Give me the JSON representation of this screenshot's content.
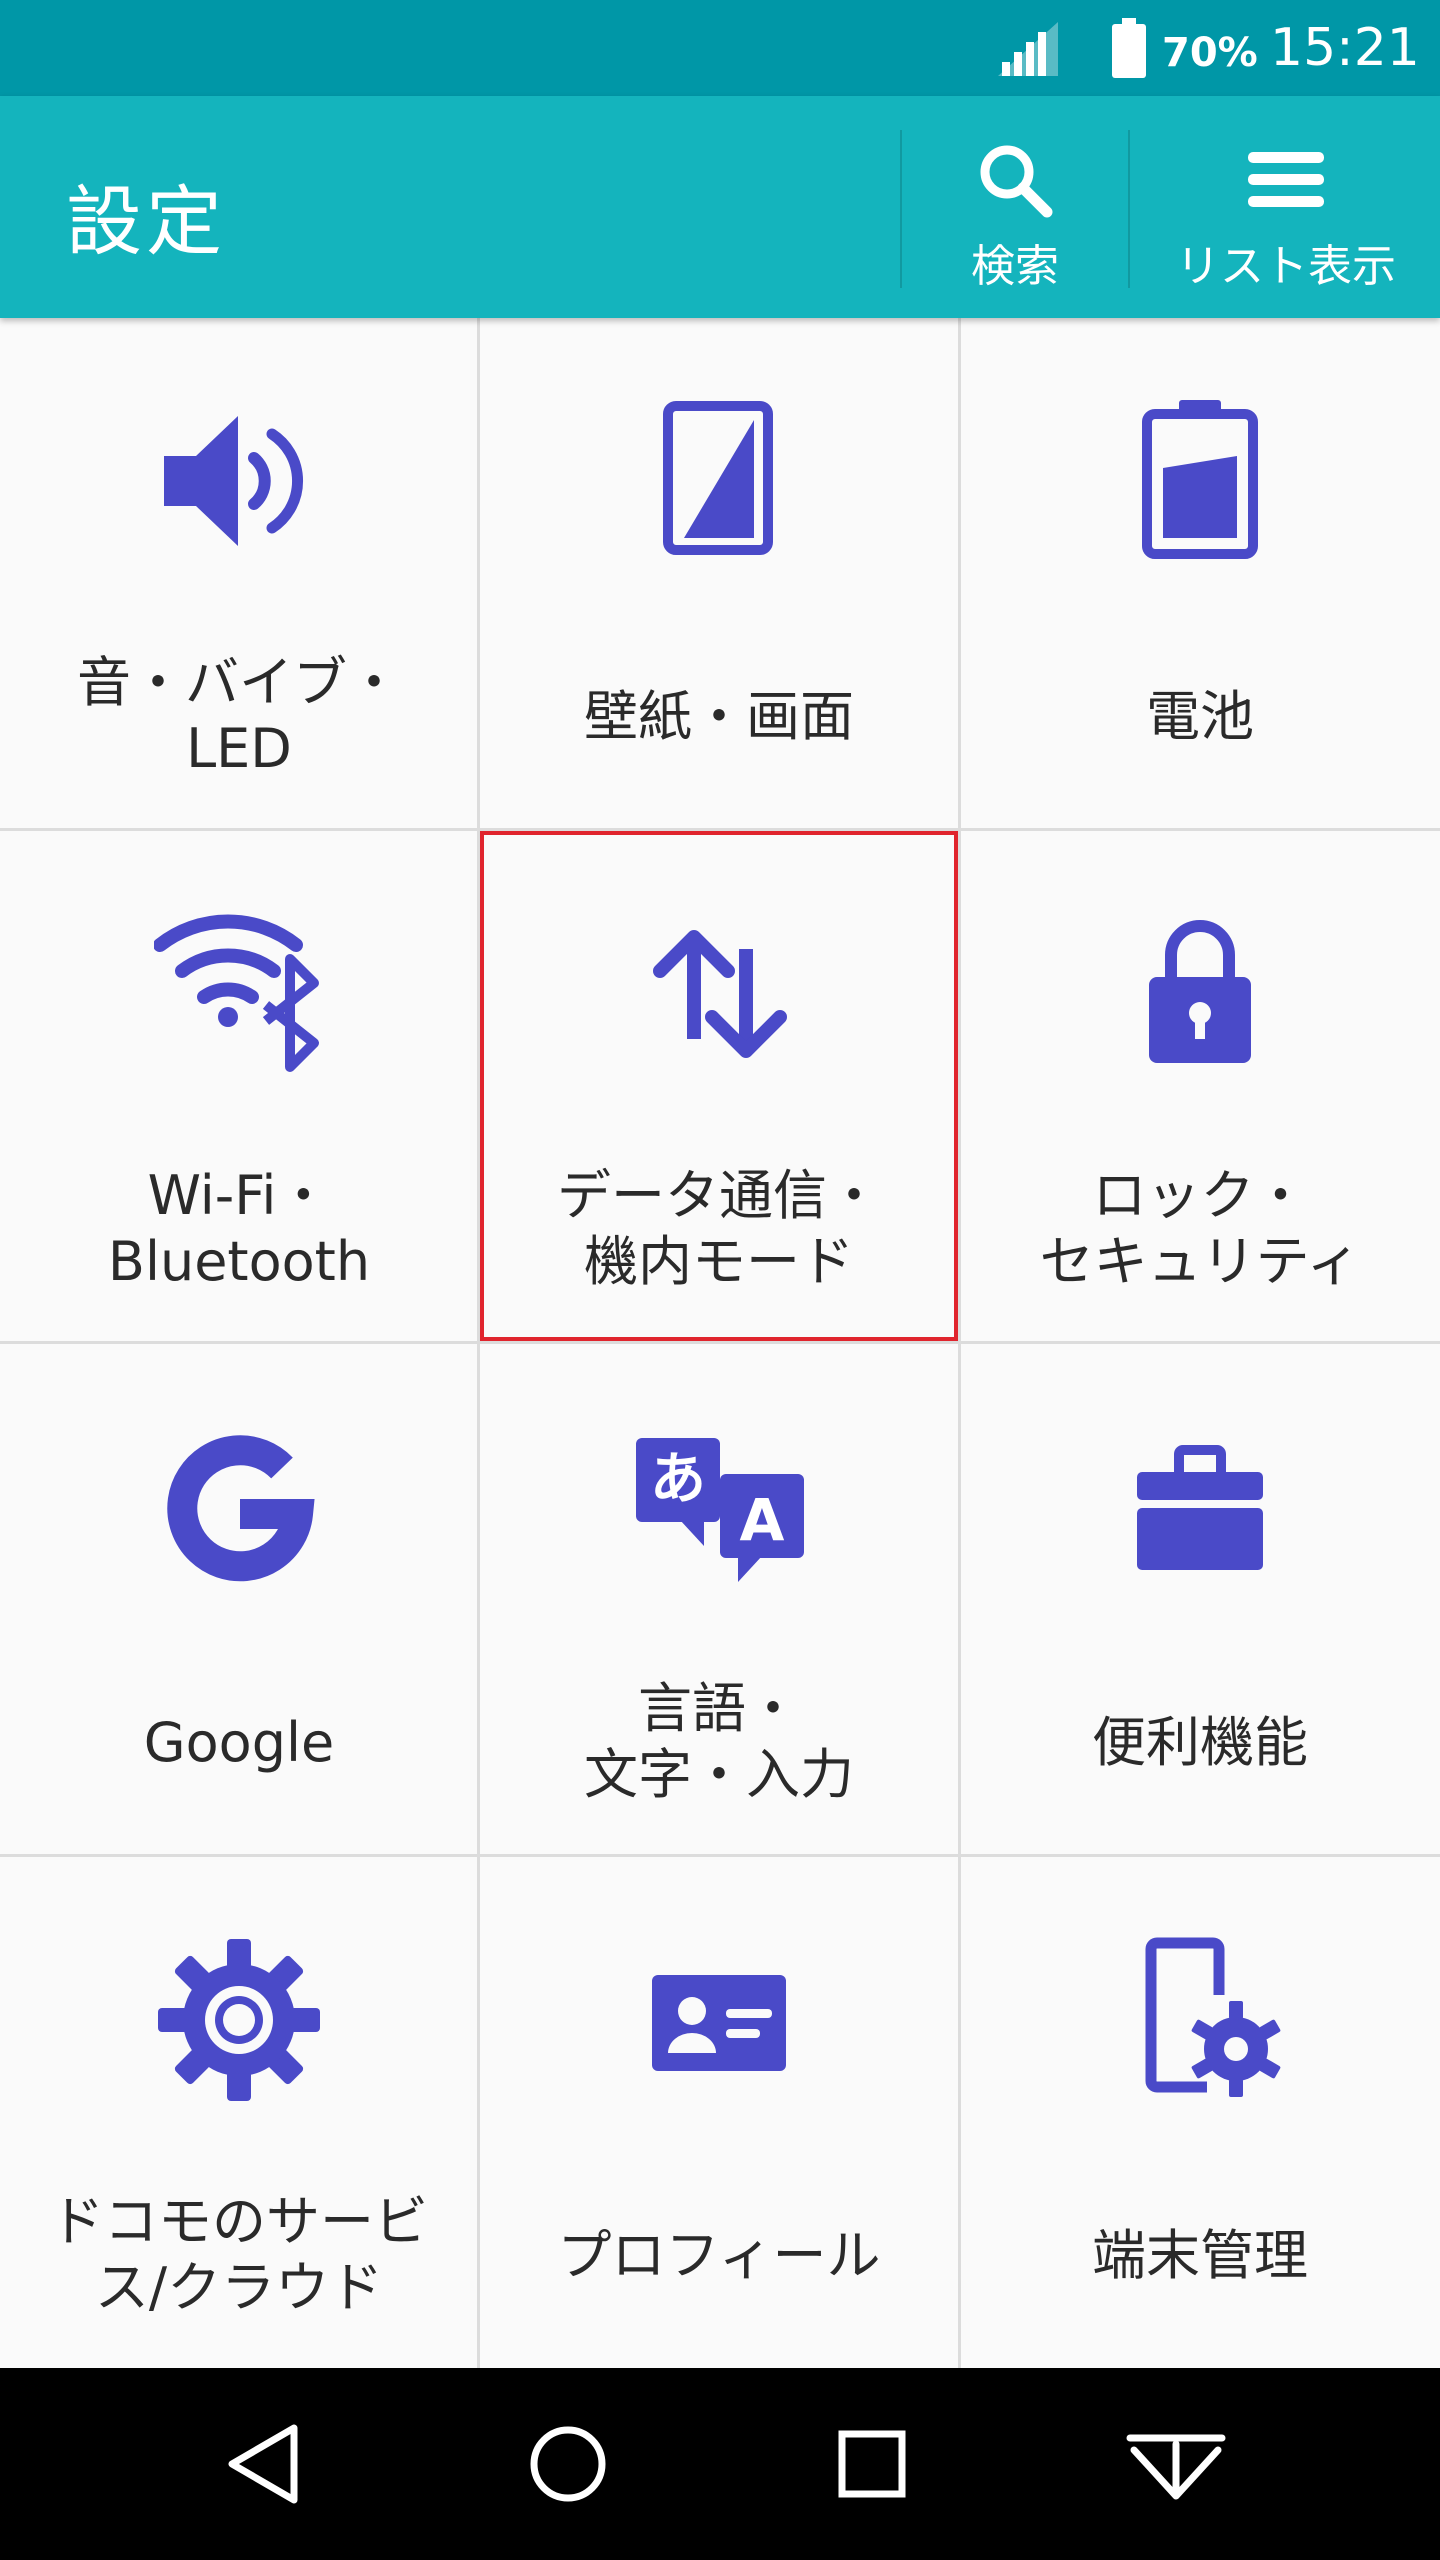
{
  "status_bar": {
    "battery_percent": "70%",
    "time": "15:21"
  },
  "app_bar": {
    "title": "設定",
    "actions": [
      {
        "icon": "search-icon",
        "label": "検索"
      },
      {
        "icon": "list-view-icon",
        "label": "リスト表示"
      }
    ]
  },
  "grid": {
    "selected_index": 4,
    "accent_color": "#4a4ac8",
    "tiles": [
      {
        "icon": "volume-icon",
        "label": "音・バイブ・\nLED"
      },
      {
        "icon": "wallpaper-screen-icon",
        "label": "壁紙・画面"
      },
      {
        "icon": "battery-icon",
        "label": "電池"
      },
      {
        "icon": "wifi-bluetooth-icon",
        "label": "Wi-Fi・\nBluetooth"
      },
      {
        "icon": "data-transfer-icon",
        "label": "データ通信・\n機内モード"
      },
      {
        "icon": "lock-icon",
        "label": "ロック・\nセキュリティ"
      },
      {
        "icon": "google-icon",
        "label": "Google"
      },
      {
        "icon": "language-icon",
        "label": "言語・\n文字・入力"
      },
      {
        "icon": "toolbox-icon",
        "label": "便利機能"
      },
      {
        "icon": "gear-icon",
        "label": "ドコモのサービ\nス/クラウド"
      },
      {
        "icon": "profile-card-icon",
        "label": "プロフィール"
      },
      {
        "icon": "device-settings-icon",
        "label": "端末管理"
      }
    ]
  },
  "nav_bar": {
    "buttons": [
      "back-icon",
      "home-icon",
      "recents-icon",
      "notification-pulldown-icon"
    ]
  }
}
